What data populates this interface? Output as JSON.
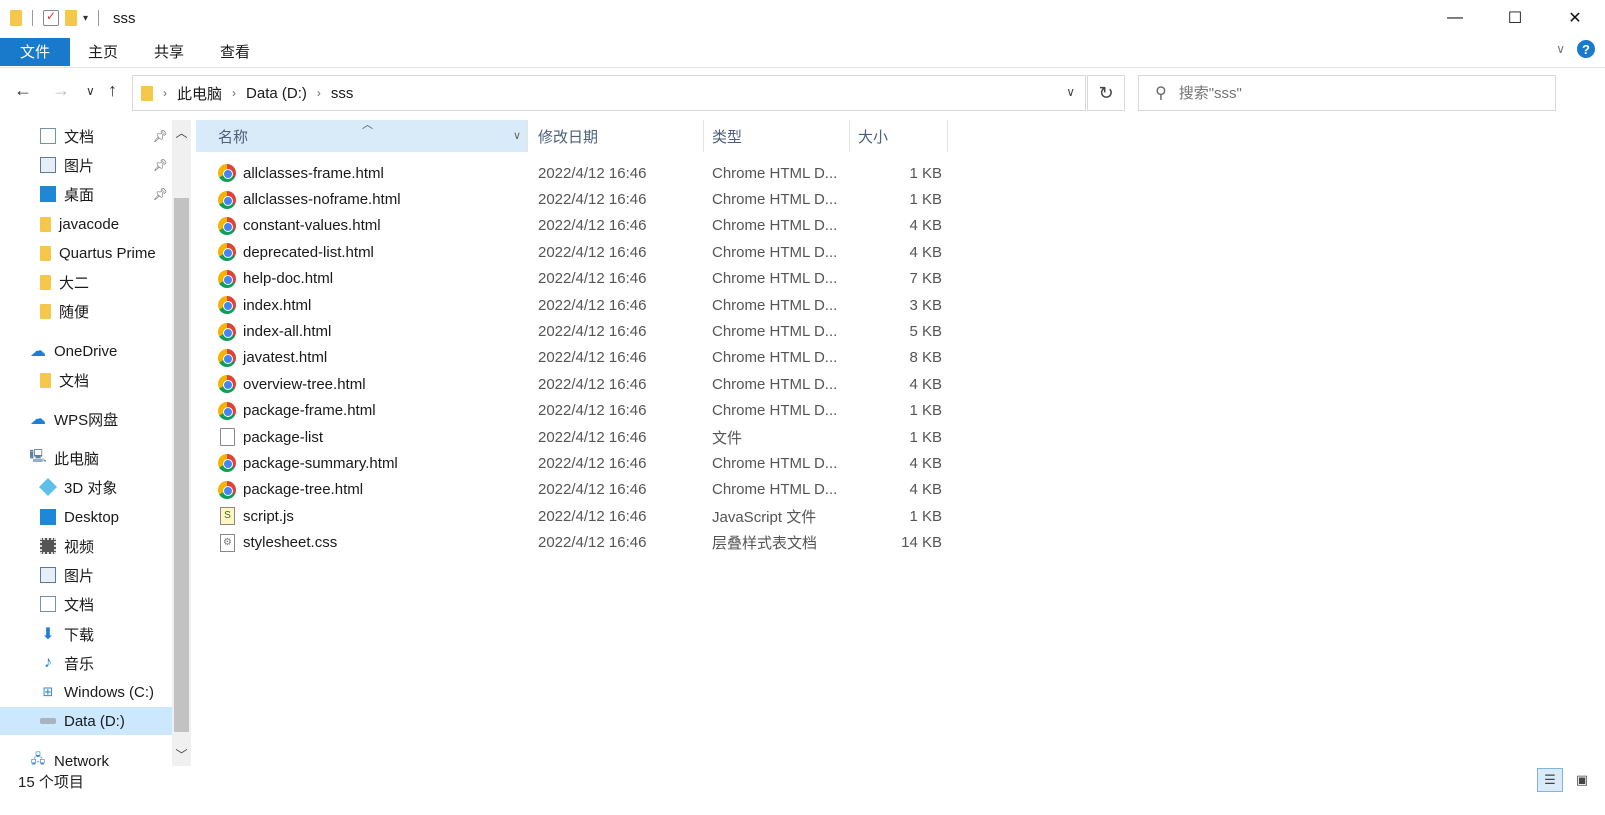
{
  "window": {
    "title": "sss",
    "controls": {
      "minimize": "—",
      "maximize": "☐",
      "close": "✕"
    }
  },
  "ribbon": {
    "tabs": [
      "文件",
      "主页",
      "共享",
      "查看"
    ],
    "expand_icon": "chevron-down-icon",
    "help_label": "?"
  },
  "nav": {
    "back": "←",
    "forward": "→",
    "recent": "∨",
    "up": "↑",
    "breadcrumb": [
      "此电脑",
      "Data (D:)",
      "sss"
    ],
    "refresh": "↻",
    "search_placeholder": "搜索\"sss\""
  },
  "sidebar": {
    "items": [
      {
        "label": "文档",
        "icon": "document-icon",
        "pinned": true
      },
      {
        "label": "图片",
        "icon": "picture-icon",
        "pinned": true
      },
      {
        "label": "桌面",
        "icon": "desktop-icon",
        "pinned": true
      },
      {
        "label": "javacode",
        "icon": "folder-icon"
      },
      {
        "label": "Quartus Prime",
        "icon": "folder-icon"
      },
      {
        "label": "大二",
        "icon": "folder-icon"
      },
      {
        "label": "随便",
        "icon": "folder-icon"
      },
      {
        "label": "OneDrive",
        "icon": "cloud-icon"
      },
      {
        "label": "文档",
        "icon": "folder-icon"
      },
      {
        "label": "WPS网盘",
        "icon": "wps-cloud-icon"
      },
      {
        "label": "此电脑",
        "icon": "computer-icon"
      },
      {
        "label": "3D 对象",
        "icon": "3d-objects-icon"
      },
      {
        "label": "Desktop",
        "icon": "desktop-icon"
      },
      {
        "label": "视频",
        "icon": "video-icon"
      },
      {
        "label": "图片",
        "icon": "picture-icon"
      },
      {
        "label": "文档",
        "icon": "document-icon"
      },
      {
        "label": "下载",
        "icon": "download-icon"
      },
      {
        "label": "音乐",
        "icon": "music-icon"
      },
      {
        "label": "Windows (C:)",
        "icon": "windows-drive-icon"
      },
      {
        "label": "Data (D:)",
        "icon": "drive-icon",
        "selected": true
      },
      {
        "label": "Network",
        "icon": "network-icon"
      }
    ]
  },
  "columns": {
    "name": "名称",
    "date": "修改日期",
    "type": "类型",
    "size": "大小"
  },
  "files": [
    {
      "name": "allclasses-frame.html",
      "date": "2022/4/12 16:46",
      "type": "Chrome HTML D...",
      "size": "1 KB",
      "icon": "chrome-icon"
    },
    {
      "name": "allclasses-noframe.html",
      "date": "2022/4/12 16:46",
      "type": "Chrome HTML D...",
      "size": "1 KB",
      "icon": "chrome-icon"
    },
    {
      "name": "constant-values.html",
      "date": "2022/4/12 16:46",
      "type": "Chrome HTML D...",
      "size": "4 KB",
      "icon": "chrome-icon"
    },
    {
      "name": "deprecated-list.html",
      "date": "2022/4/12 16:46",
      "type": "Chrome HTML D...",
      "size": "4 KB",
      "icon": "chrome-icon"
    },
    {
      "name": "help-doc.html",
      "date": "2022/4/12 16:46",
      "type": "Chrome HTML D...",
      "size": "7 KB",
      "icon": "chrome-icon"
    },
    {
      "name": "index.html",
      "date": "2022/4/12 16:46",
      "type": "Chrome HTML D...",
      "size": "3 KB",
      "icon": "chrome-icon"
    },
    {
      "name": "index-all.html",
      "date": "2022/4/12 16:46",
      "type": "Chrome HTML D...",
      "size": "5 KB",
      "icon": "chrome-icon"
    },
    {
      "name": "javatest.html",
      "date": "2022/4/12 16:46",
      "type": "Chrome HTML D...",
      "size": "8 KB",
      "icon": "chrome-icon"
    },
    {
      "name": "overview-tree.html",
      "date": "2022/4/12 16:46",
      "type": "Chrome HTML D...",
      "size": "4 KB",
      "icon": "chrome-icon"
    },
    {
      "name": "package-frame.html",
      "date": "2022/4/12 16:46",
      "type": "Chrome HTML D...",
      "size": "1 KB",
      "icon": "chrome-icon"
    },
    {
      "name": "package-list",
      "date": "2022/4/12 16:46",
      "type": "文件",
      "size": "1 KB",
      "icon": "file-icon"
    },
    {
      "name": "package-summary.html",
      "date": "2022/4/12 16:46",
      "type": "Chrome HTML D...",
      "size": "4 KB",
      "icon": "chrome-icon"
    },
    {
      "name": "package-tree.html",
      "date": "2022/4/12 16:46",
      "type": "Chrome HTML D...",
      "size": "4 KB",
      "icon": "chrome-icon"
    },
    {
      "name": "script.js",
      "date": "2022/4/12 16:46",
      "type": "JavaScript 文件",
      "size": "1 KB",
      "icon": "js-file-icon"
    },
    {
      "name": "stylesheet.css",
      "date": "2022/4/12 16:46",
      "type": "层叠样式表文档",
      "size": "14 KB",
      "icon": "css-file-icon"
    }
  ],
  "status": {
    "count": "15 个项目"
  },
  "colors": {
    "accent": "#1979ca",
    "selection": "#cce8ff",
    "header_sorted": "#d9ebf9"
  }
}
